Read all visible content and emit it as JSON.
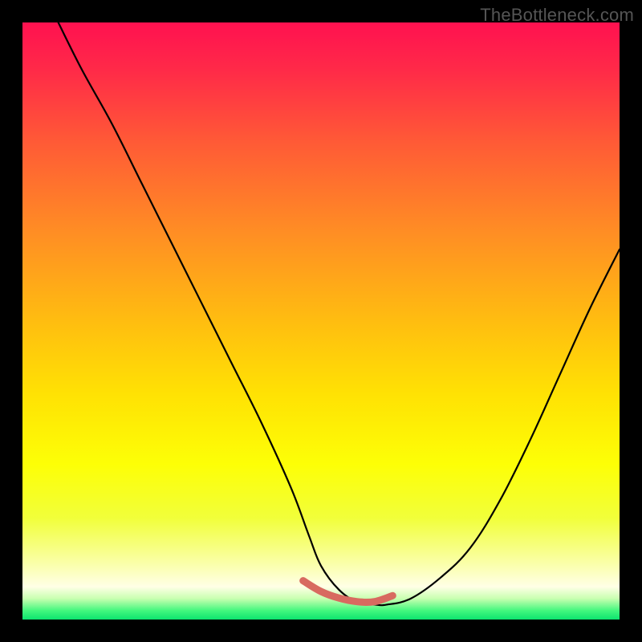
{
  "watermark": "TheBottleneck.com",
  "colors": {
    "background": "#000000",
    "curve": "#000000",
    "marker": "#d86a60",
    "gradient_stops": [
      {
        "offset": 0.0,
        "color": "#ff1150"
      },
      {
        "offset": 0.08,
        "color": "#ff2a48"
      },
      {
        "offset": 0.2,
        "color": "#ff5a36"
      },
      {
        "offset": 0.35,
        "color": "#ff8d24"
      },
      {
        "offset": 0.5,
        "color": "#ffbd10"
      },
      {
        "offset": 0.62,
        "color": "#ffe104"
      },
      {
        "offset": 0.74,
        "color": "#fdff06"
      },
      {
        "offset": 0.83,
        "color": "#f1ff3a"
      },
      {
        "offset": 0.905,
        "color": "#faffa7"
      },
      {
        "offset": 0.945,
        "color": "#ffffe6"
      },
      {
        "offset": 0.965,
        "color": "#c8ffb0"
      },
      {
        "offset": 0.985,
        "color": "#43f77e"
      },
      {
        "offset": 1.0,
        "color": "#0de36f"
      }
    ]
  },
  "chart_data": {
    "type": "line",
    "title": "",
    "xlabel": "",
    "ylabel": "",
    "xlim": [
      0,
      100
    ],
    "ylim": [
      0,
      100
    ],
    "grid": false,
    "legend": false,
    "series": [
      {
        "name": "curve",
        "x": [
          6,
          10,
          15,
          20,
          25,
          30,
          35,
          40,
          45,
          48,
          50,
          53,
          56,
          59,
          61,
          65,
          70,
          75,
          80,
          85,
          90,
          95,
          100
        ],
        "y": [
          100,
          92,
          83,
          73,
          63,
          53,
          43,
          33,
          22,
          14,
          9,
          5,
          3,
          2.5,
          2.5,
          3.5,
          7,
          12,
          20,
          30,
          41,
          52,
          62
        ]
      }
    ],
    "markers": {
      "name": "highlight-band",
      "x": [
        47,
        50,
        53,
        56,
        59,
        62
      ],
      "y": [
        6.5,
        4.7,
        3.6,
        3.0,
        3.0,
        4.0
      ]
    }
  }
}
